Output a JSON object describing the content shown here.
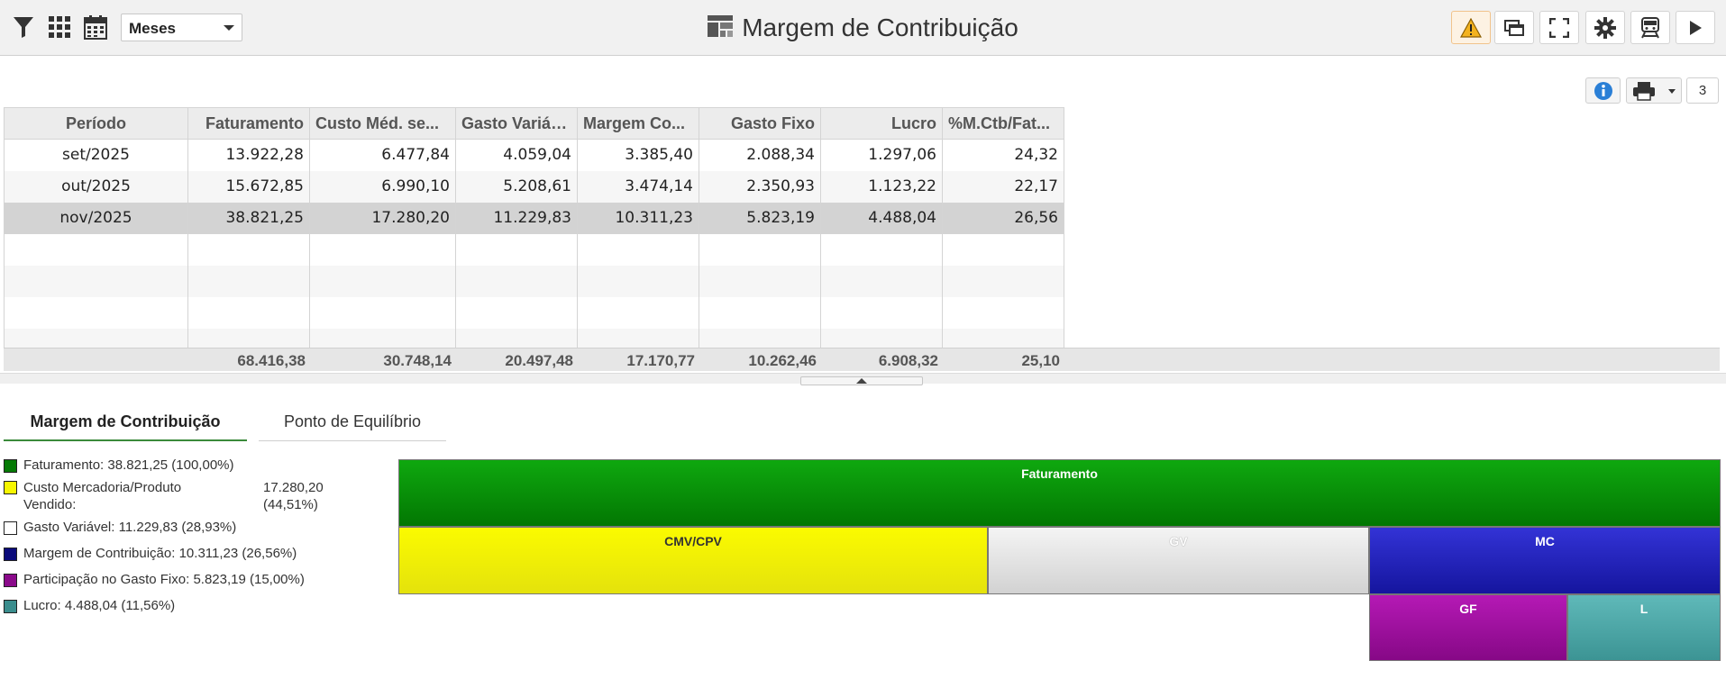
{
  "toolbar": {
    "period_select": "Meses",
    "title": "Margem de Contribuição",
    "page_count": "3"
  },
  "icons": {
    "filter": "filter-icon",
    "grid": "grid-icon",
    "calendar": "calendar-icon",
    "report": "report-icon",
    "warning": "warning-icon",
    "windows": "windows-icon",
    "fullscreen": "fullscreen-icon",
    "settings": "gear-icon",
    "train": "train-icon",
    "play": "play-icon",
    "info": "info-icon",
    "print": "print-icon"
  },
  "colors": {
    "faturamento": "#079307",
    "cmv": "#f4f400",
    "gv": "#f2f2f2",
    "mc": "#1f1fc4",
    "gf": "#a312a3",
    "lucro": "#4aa6a6",
    "warning_bg": "#fdf2e3"
  },
  "grid": {
    "columns": [
      "Período",
      "Faturamento",
      "Custo Méd. se...",
      "Gasto Variável",
      "Margem Co...",
      "Gasto Fixo",
      "Lucro",
      "%M.Ctb/Fat..."
    ],
    "rows": [
      [
        "set/2025",
        "13.922,28",
        "6.477,84",
        "4.059,04",
        "3.385,40",
        "2.088,34",
        "1.297,06",
        "24,32"
      ],
      [
        "out/2025",
        "15.672,85",
        "6.990,10",
        "5.208,61",
        "3.474,14",
        "2.350,93",
        "1.123,22",
        "22,17"
      ],
      [
        "nov/2025",
        "38.821,25",
        "17.280,20",
        "11.229,83",
        "10.311,23",
        "5.823,19",
        "4.488,04",
        "26,56"
      ]
    ],
    "selected_row": 2,
    "totals": [
      "68.416,38",
      "30.748,14",
      "20.497,48",
      "17.170,77",
      "10.262,46",
      "6.908,32",
      "25,10"
    ]
  },
  "tabs": [
    "Margem de Contribuição",
    "Ponto de Equilíbrio"
  ],
  "legend": [
    {
      "label": "Faturamento:",
      "value": "38.821,25 (100,00%)"
    },
    {
      "label": "Custo Mercadoria/Produto Vendido:",
      "value": "17.280,20 (44,51%)"
    },
    {
      "label": "Gasto Variável:",
      "value": "11.229,83 (28,93%)"
    },
    {
      "label": "Margem de Contribuição:",
      "value": "10.311,23 (26,56%)"
    },
    {
      "label": "Participação no Gasto Fixo:",
      "value": "5.823,19 (15,00%)"
    },
    {
      "label": "Lucro:",
      "value": "4.488,04 (11,56%)"
    }
  ],
  "treemap": {
    "faturamento": "Faturamento",
    "cmv": "CMV/CPV",
    "gv": "GV",
    "mc": "MC",
    "gf": "GF",
    "lucro": "L"
  }
}
